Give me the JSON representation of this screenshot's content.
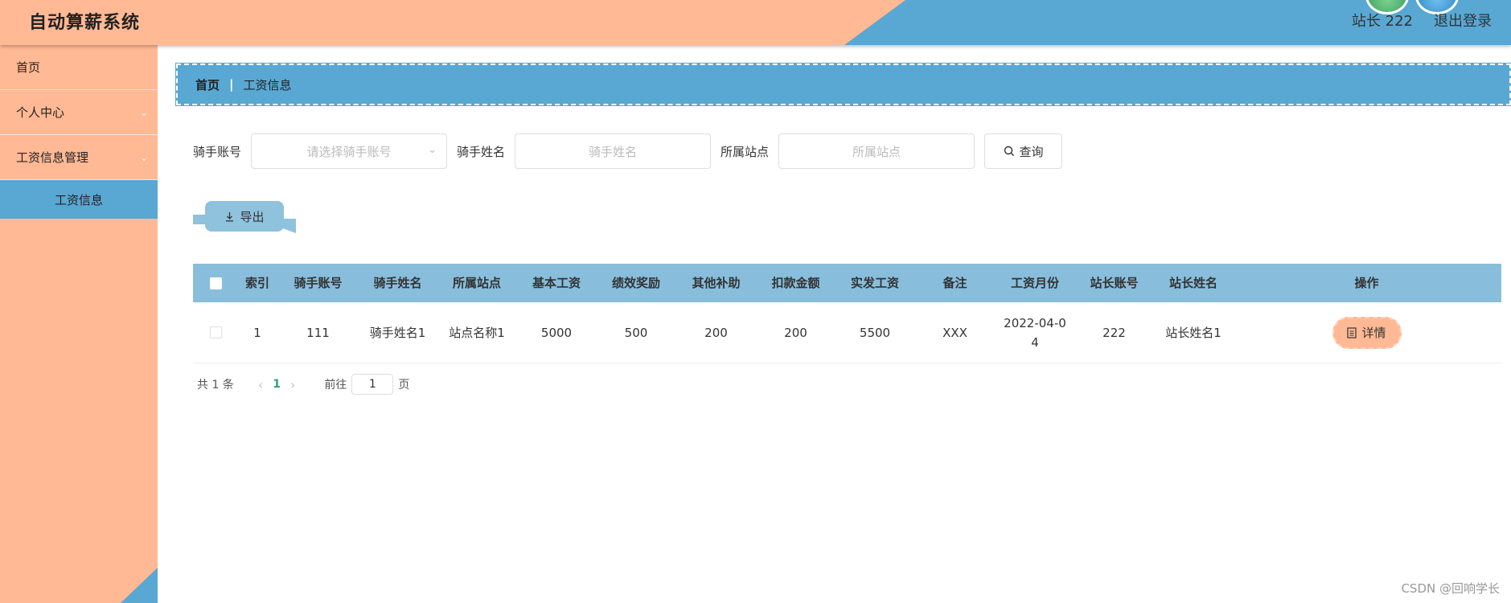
{
  "header": {
    "app_title": "自动算薪系统",
    "user_label": "站长 222",
    "logout_label": "退出登录"
  },
  "sidebar": {
    "items": [
      {
        "label": "首页"
      },
      {
        "label": "个人中心"
      },
      {
        "label": "工资信息管理"
      }
    ],
    "sub_item_label": "工资信息"
  },
  "breadcrumb": {
    "home": "首页",
    "separator": "|",
    "current": "工资信息"
  },
  "search": {
    "rider_account_label": "骑手账号",
    "rider_account_placeholder": "请选择骑手账号",
    "rider_name_label": "骑手姓名",
    "rider_name_placeholder": "骑手姓名",
    "station_label": "所属站点",
    "station_placeholder": "所属站点",
    "query_label": "查询"
  },
  "toolbar": {
    "export_label": "导出"
  },
  "table": {
    "headers": [
      "索引",
      "骑手账号",
      "骑手姓名",
      "所属站点",
      "基本工资",
      "绩效奖励",
      "其他补助",
      "扣款金额",
      "实发工资",
      "备注",
      "工资月份",
      "站长账号",
      "站长姓名",
      "操作"
    ],
    "rows": [
      {
        "index": "1",
        "rider_account": "111",
        "rider_name": "骑手姓名1",
        "station": "站点名称1",
        "base_salary": "5000",
        "bonus": "500",
        "subsidy": "200",
        "deduction": "200",
        "net_salary": "5500",
        "remark": "XXX",
        "month": "2022-04-04",
        "manager_account": "222",
        "manager_name": "站长姓名1",
        "action_label": "详情"
      }
    ]
  },
  "pagination": {
    "total_text": "共 1 条",
    "current_page": "1",
    "goto_label": "前往",
    "goto_value": "1",
    "page_suffix": "页"
  },
  "watermark": "CSDN @回响学长",
  "colors": {
    "header_peach": "#ffb994",
    "header_blue": "#58a8d3",
    "table_header": "#88bedc",
    "page_active": "#2ba471"
  }
}
